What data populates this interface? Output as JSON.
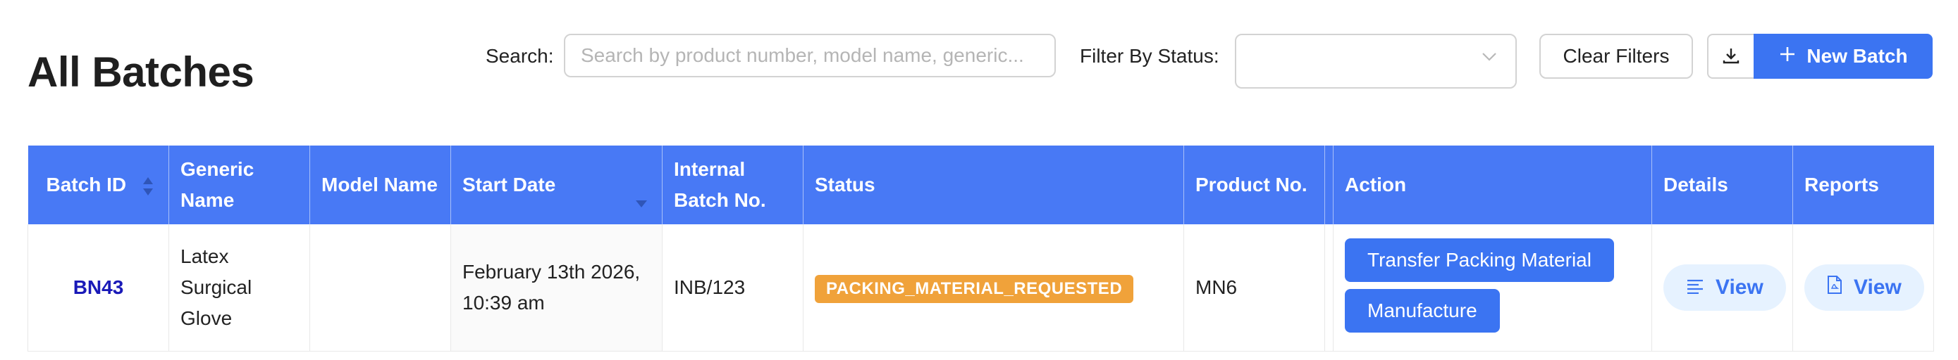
{
  "page": {
    "title": "All Batches"
  },
  "toolbar": {
    "search_label": "Search:",
    "search_placeholder": "Search by product number, model name, generic...",
    "search_value": "",
    "filter_label": "Filter By Status:",
    "filter_value": "",
    "clear_label": "Clear Filters",
    "download_icon": "download-icon",
    "new_batch_label": "New Batch",
    "new_batch_icon": "plus-icon"
  },
  "table": {
    "columns": [
      "Batch ID",
      "Generic Name",
      "Model Name",
      "Start Date",
      "Internal Batch No.",
      "Status",
      "Product No.",
      "",
      "Action",
      "Details",
      "Reports"
    ],
    "rows": [
      {
        "batch_id": "BN43",
        "generic_name": "Latex Surgical Glove",
        "model_name": "",
        "start_date": "February 13th 2026, 10:39 am",
        "internal_batch_no": "INB/123",
        "status": "PACKING_MATERIAL_REQUESTED",
        "product_no": "MN6",
        "actions": [
          "Transfer Packing Material",
          "Manufacture"
        ],
        "details_label": "View",
        "reports_label": "View"
      }
    ]
  },
  "colors": {
    "primary": "#3b74f2",
    "header_bg": "#4879f5",
    "status_tag": "#f0a23a",
    "view_bg": "#e6f2ff",
    "link": "#1a1ab8"
  }
}
